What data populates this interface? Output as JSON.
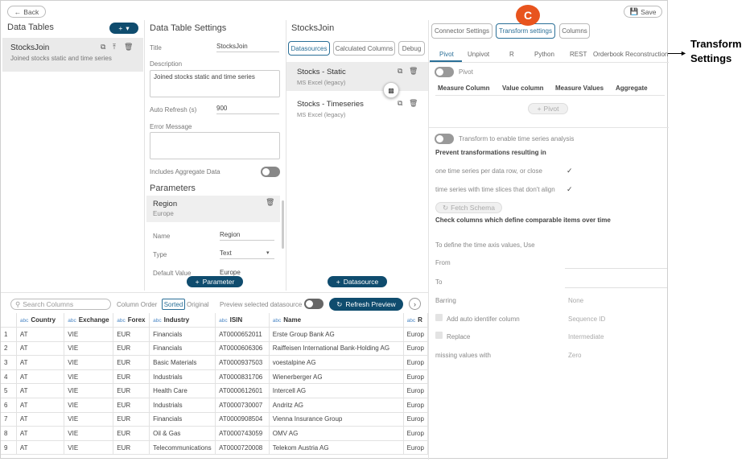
{
  "header": {
    "back_label": "Back",
    "save_label": "Save"
  },
  "data_tables": {
    "title": "Data Tables",
    "items": [
      {
        "name": "StocksJoin",
        "description": "Joined stocks static and time series"
      }
    ]
  },
  "settings": {
    "title": "Data Table Settings",
    "title_label": "Title",
    "title_value": "StocksJoin",
    "description_label": "Description",
    "description_value": "Joined stocks static and time series",
    "auto_refresh_label": "Auto Refresh (s)",
    "auto_refresh_value": "900",
    "error_message_label": "Error Message",
    "includes_aggregate_label": "Includes Aggregate Data",
    "parameters_title": "Parameters",
    "parameter": {
      "name": "Region",
      "value": "Europe",
      "name_label": "Name",
      "name_value": "Region",
      "type_label": "Type",
      "type_value": "Text",
      "default_label": "Default Value",
      "default_value": "Europe"
    },
    "add_parameter_label": "Parameter"
  },
  "join": {
    "title": "StocksJoin",
    "tabs": [
      "Datasources",
      "Calculated Columns",
      "Debug"
    ],
    "datasources": [
      {
        "name": "Stocks - Static",
        "type": "MS Excel (legacy)"
      },
      {
        "name": "Stocks - Timeseries",
        "type": "MS Excel (legacy)"
      }
    ],
    "add_datasource_label": "Datasource"
  },
  "connector": {
    "top_tabs": [
      "Connector Settings",
      "Transform settings",
      "Columns"
    ],
    "badge": "C",
    "sub_tabs": [
      "Pivot",
      "Unpivot",
      "R",
      "Python",
      "REST",
      "Orderbook Reconstruction"
    ],
    "pivot_label": "Pivot",
    "pivot_headers": [
      "Measure Column",
      "Value column",
      "Measure Values",
      "Aggregate"
    ],
    "add_pivot_label": "Pivot",
    "ts_toggle_label": "Transform to enable time series analysis",
    "prevent_title": "Prevent transformations resulting in",
    "prevent_opt1": "one time series per data row, or close",
    "prevent_opt2": "time series with time slices that don't align",
    "fetch_schema_label": "Fetch Schema",
    "check_columns_title": "Check columns which define comparable items over time",
    "time_axis_label": "To define the time axis values, Use",
    "from_label": "From",
    "to_label": "To",
    "barring_label": "Barring",
    "barring_value": "None",
    "auto_id_label": "Add auto identifer column",
    "auto_id_value": "Sequence ID",
    "replace_label": "Replace",
    "replace_value": "Intermediate",
    "missing_label": "missing values with",
    "missing_value": "Zero"
  },
  "callout": {
    "line1": "Transform",
    "line2": "Settings"
  },
  "preview": {
    "search_placeholder": "Search Columns",
    "column_order_label": "Column Order",
    "sorted_label": "Sorted",
    "original_label": "Original",
    "preview_label": "Preview selected datasource",
    "refresh_label": "Refresh Preview",
    "columns": [
      "Country",
      "Exchange",
      "Forex",
      "Industry",
      "ISIN",
      "Name",
      "R"
    ],
    "type_tag": "abc",
    "rows": [
      [
        "1",
        "AT",
        "VIE",
        "EUR",
        "Financials",
        "AT0000652011",
        "Erste Group Bank AG",
        "Europ"
      ],
      [
        "2",
        "AT",
        "VIE",
        "EUR",
        "Financials",
        "AT0000606306",
        "Raiffeisen International Bank-Holding AG",
        "Europ"
      ],
      [
        "3",
        "AT",
        "VIE",
        "EUR",
        "Basic Materials",
        "AT0000937503",
        "voestalpine AG",
        "Europ"
      ],
      [
        "4",
        "AT",
        "VIE",
        "EUR",
        "Industrials",
        "AT0000831706",
        "Wienerberger AG",
        "Europ"
      ],
      [
        "5",
        "AT",
        "VIE",
        "EUR",
        "Health Care",
        "AT0000612601",
        "Intercell AG",
        "Europ"
      ],
      [
        "6",
        "AT",
        "VIE",
        "EUR",
        "Industrials",
        "AT0000730007",
        "Andritz AG",
        "Europ"
      ],
      [
        "7",
        "AT",
        "VIE",
        "EUR",
        "Financials",
        "AT0000908504",
        "Vienna Insurance Group",
        "Europ"
      ],
      [
        "8",
        "AT",
        "VIE",
        "EUR",
        "Oil & Gas",
        "AT0000743059",
        "OMV AG",
        "Europ"
      ],
      [
        "9",
        "AT",
        "VIE",
        "EUR",
        "Telecommunications",
        "AT0000720008",
        "Telekom Austria AG",
        "Europ"
      ]
    ]
  },
  "colors": {
    "accent": "#0f4c6e",
    "tab_active": "#2a6f97",
    "badge": "#e8541e"
  }
}
